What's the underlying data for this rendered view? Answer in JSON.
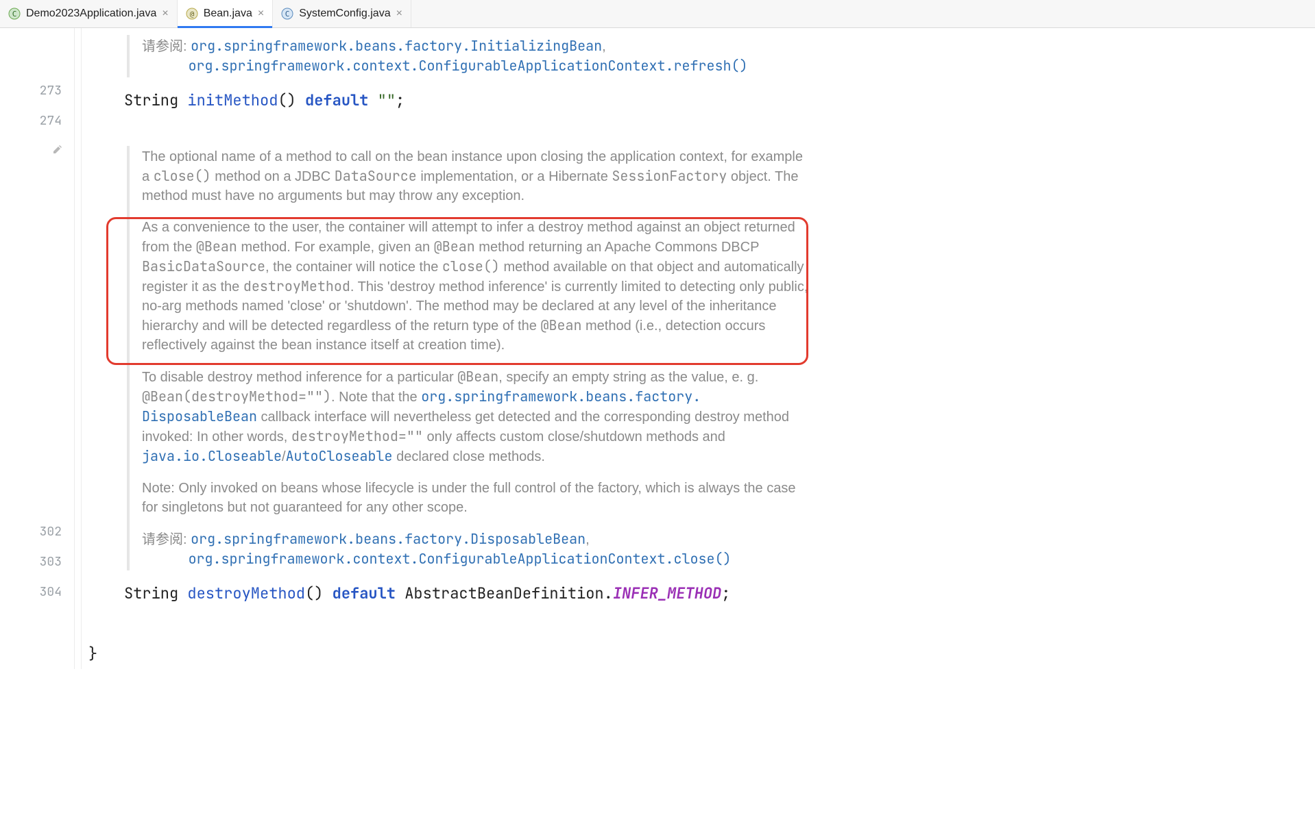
{
  "tabs": [
    {
      "name": "Demo2023Application.java",
      "active": false,
      "icon": "class"
    },
    {
      "name": "Bean.java",
      "active": true,
      "icon": "annotation"
    },
    {
      "name": "SystemConfig.java",
      "active": false,
      "icon": "class"
    }
  ],
  "gutter": {
    "l273": "273",
    "l274": "274",
    "l302": "302",
    "l303": "303",
    "l304": "304"
  },
  "doc1": {
    "see_label": "请参阅:",
    "see1": "org.springframework.beans.factory.InitializingBean",
    "see2": "org.springframework.context.ConfigurableApplicationContext.refresh()"
  },
  "line273": {
    "type": "String",
    "name": "initMethod",
    "paren": "()",
    "kw": "default",
    "val": "\"\"",
    "semi": ";"
  },
  "doc2": {
    "p1_a": "The optional name of a method to call on the bean instance upon closing the application context, for example a ",
    "p1_code1": "close()",
    "p1_b": " method on a JDBC ",
    "p1_code2": "DataSource",
    "p1_c": " implementation, or a Hibernate ",
    "p1_code3": "SessionFactory",
    "p1_d": " object. The method must have no arguments but may throw any exception.",
    "p2_a": "As a convenience to the user, the container will attempt to infer a destroy method against an object returned from the ",
    "p2_code1": "@Bean",
    "p2_b": " method. For example, given an ",
    "p2_code2": "@Bean",
    "p2_c": " method returning an Apache Commons DBCP ",
    "p2_code3": "BasicDataSource",
    "p2_d": ", the container will notice the ",
    "p2_code4": "close()",
    "p2_e": " method available on that object and automatically register it as the ",
    "p2_code5": "destroyMethod",
    "p2_f": ". This 'destroy method inference' is currently limited to detecting only public, no-arg methods named 'close' or 'shutdown'. The method may be declared at any level of the inheritance hierarchy and will be detected regardless of the return type of the ",
    "p2_code6": "@Bean",
    "p2_g": " method (i.e., detection occurs reflectively against the bean instance itself at creation time).",
    "p3_a": "To disable destroy method inference for a particular ",
    "p3_code1": "@Bean",
    "p3_b": ", specify an empty string as the value, e. g. ",
    "p3_code2": "@Bean(destroyMethod=\"\")",
    "p3_c": ". Note that the ",
    "p3_link1": "org.springframework.beans.factory. DisposableBean",
    "p3_d": " callback interface will nevertheless get detected and the corresponding destroy method invoked: In other words, ",
    "p3_code3": "destroyMethod=\"\"",
    "p3_e": " only affects custom close/shutdown methods and ",
    "p3_link2": "java.io.Closeable",
    "p3_f": "/",
    "p3_link3": "AutoCloseable",
    "p3_g": " declared close methods.",
    "p4": "Note: Only invoked on beans whose lifecycle is under the full control of the factory, which is always the case for singletons but not guaranteed for any other scope.",
    "see_label": "请参阅:",
    "see1": "org.springframework.beans.factory.DisposableBean",
    "see2": "org.springframework.context.ConfigurableApplicationContext.close()"
  },
  "line302": {
    "type": "String",
    "name": "destroyMethod",
    "paren": "()",
    "kw": "default",
    "cls": "AbstractBeanDefinition",
    "dot": ".",
    "const": "INFER_METHOD",
    "semi": ";"
  },
  "line304": {
    "brace": "}"
  }
}
